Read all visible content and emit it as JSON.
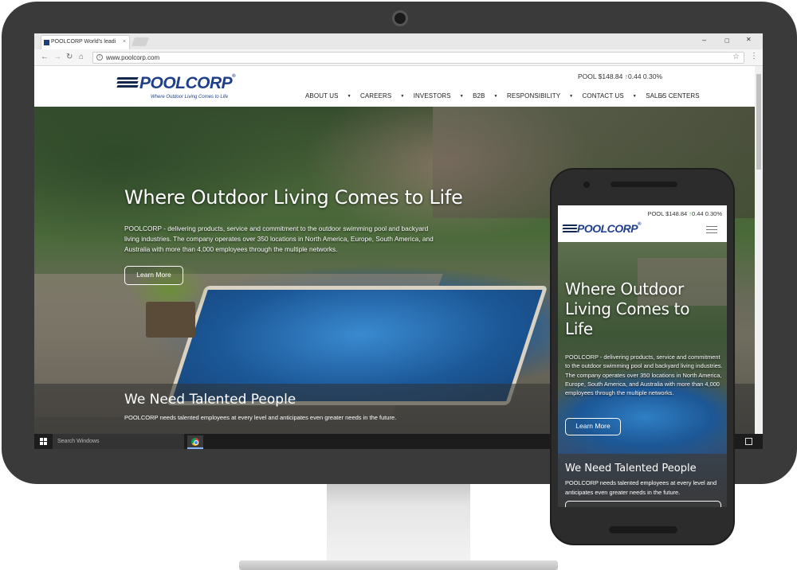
{
  "browser": {
    "tab_title": "POOLCORP World's leadi",
    "tab_close": "×",
    "url": "www.poolcorp.com",
    "window_controls": {
      "minimize": "–",
      "maximize": "▢",
      "close": "✕"
    },
    "nav_icons": {
      "back": "←",
      "forward": "→",
      "reload": "↻",
      "home": "⌂",
      "star": "☆",
      "menu": "⋮",
      "info": "i"
    }
  },
  "site": {
    "logo": {
      "name": "POOLCORP",
      "trademark": "®",
      "tagline": "Where Outdoor Living Comes to Life"
    },
    "stock": {
      "label": "POOL $148.84",
      "arrow": "↑",
      "change": "0.44 0.30%"
    },
    "nav": [
      {
        "label": "ABOUT US",
        "caret": "▼"
      },
      {
        "label": "CAREERS",
        "caret": "▼"
      },
      {
        "label": "INVESTORS",
        "caret": "▼"
      },
      {
        "label": "B2B",
        "caret": "▼"
      },
      {
        "label": "RESPONSIBILITY",
        "caret": "▼"
      },
      {
        "label": "CONTACT US",
        "caret": "▼"
      },
      {
        "label": "SALES CENTERS",
        "caret": ""
      }
    ],
    "search_icon": "⌕",
    "hero": {
      "title": "Where Outdoor Living Comes to Life",
      "body": "POOLCORP - delivering products, service and commitment to the outdoor swimming pool and backyard living industries. The company operates over 350 locations in North America, Europe, South America, and Australia with more than 4,000 employees through the multiple networks.",
      "button": "Learn More"
    },
    "band": {
      "title": "We Need Talented People",
      "body": "POOLCORP needs talented employees at every level and anticipates even greater needs in the future."
    }
  },
  "taskbar": {
    "search_placeholder": "Search Windows"
  },
  "colors": {
    "brand": "#1f3f8a",
    "stock_up": "#2e9a35",
    "bezel": "#3a3a3a"
  }
}
